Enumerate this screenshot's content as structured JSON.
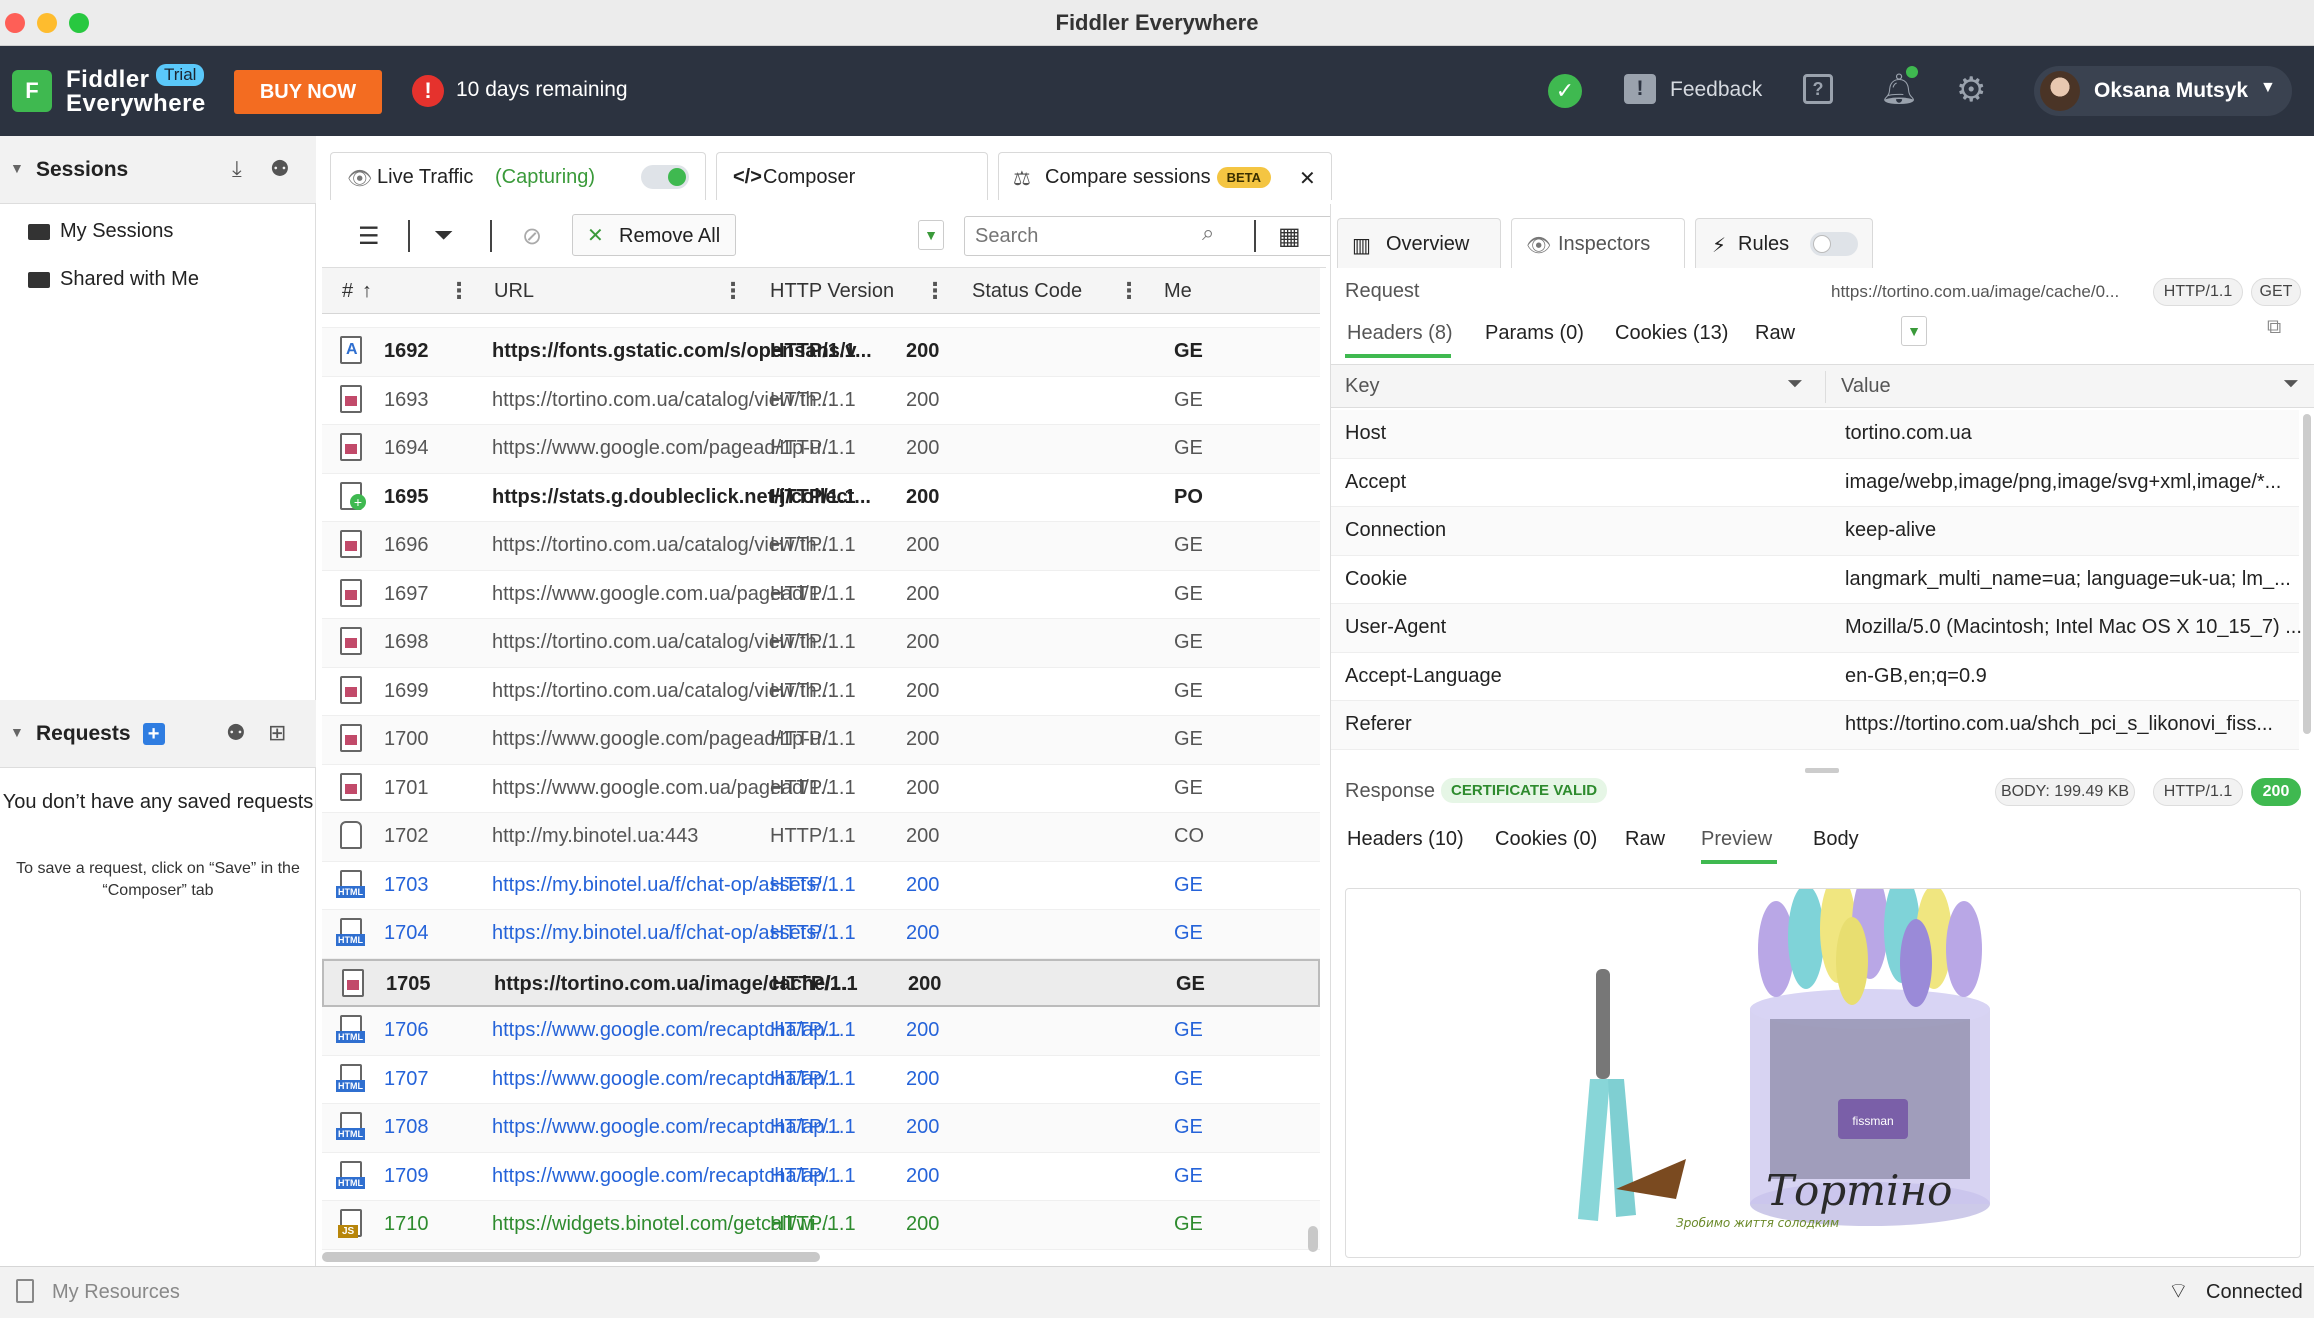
{
  "window": {
    "title": "Fiddler Everywhere"
  },
  "header": {
    "brand_line1": "Fiddler",
    "brand_line2": "Everywhere",
    "trial_badge": "Trial",
    "buy_now": "BUY NOW",
    "trial_remaining": "10 days remaining",
    "feedback": "Feedback",
    "user_name": "Oksana Mutsyk",
    "accent_color": "#f36c21"
  },
  "sidebar": {
    "sessions_title": "Sessions",
    "items": [
      {
        "label": "My Sessions"
      },
      {
        "label": "Shared with Me"
      }
    ],
    "requests_title": "Requests",
    "empty_title": "You don’t have any saved requests",
    "empty_hint": "To save a request, click on “Save” in the “Composer” tab"
  },
  "tabs": {
    "live_traffic": "Live Traffic",
    "capturing": "(Capturing)",
    "composer": "Composer",
    "compare_sessions": "Compare sessions",
    "beta": "BETA"
  },
  "toolbar": {
    "remove_all": "Remove All",
    "search_placeholder": "Search"
  },
  "grid": {
    "columns": [
      "#",
      "URL",
      "HTTP Version",
      "Status Code",
      "Me"
    ],
    "rows": [
      {
        "id": "1692",
        "url": "https://fonts.gstatic.com/s/opensans/v...",
        "version": "HTTP/1.1",
        "status": "200",
        "method": "GE",
        "icon": "font",
        "style": "bold"
      },
      {
        "id": "1693",
        "url": "https://tortino.com.ua/catalog/view/th...",
        "version": "HTTP/1.1",
        "status": "200",
        "method": "GE",
        "icon": "img",
        "style": "normal"
      },
      {
        "id": "1694",
        "url": "https://www.google.com/pagead/1p-u...",
        "version": "HTTP/1.1",
        "status": "200",
        "method": "GE",
        "icon": "img",
        "style": "normal"
      },
      {
        "id": "1695",
        "url": "https://stats.g.doubleclick.net/j/collect...",
        "version": "HTTP/1.1",
        "status": "200",
        "method": "PO",
        "icon": "post",
        "style": "bold"
      },
      {
        "id": "1696",
        "url": "https://tortino.com.ua/catalog/view/th...",
        "version": "HTTP/1.1",
        "status": "200",
        "method": "GE",
        "icon": "img",
        "style": "normal"
      },
      {
        "id": "1697",
        "url": "https://www.google.com.ua/pagead/1...",
        "version": "HTTP/1.1",
        "status": "200",
        "method": "GE",
        "icon": "img",
        "style": "normal"
      },
      {
        "id": "1698",
        "url": "https://tortino.com.ua/catalog/view/th...",
        "version": "HTTP/1.1",
        "status": "200",
        "method": "GE",
        "icon": "img",
        "style": "normal"
      },
      {
        "id": "1699",
        "url": "https://tortino.com.ua/catalog/view/th...",
        "version": "HTTP/1.1",
        "status": "200",
        "method": "GE",
        "icon": "img",
        "style": "normal"
      },
      {
        "id": "1700",
        "url": "https://www.google.com/pagead/1p-u...",
        "version": "HTTP/1.1",
        "status": "200",
        "method": "GE",
        "icon": "img",
        "style": "normal"
      },
      {
        "id": "1701",
        "url": "https://www.google.com.ua/pagead/1...",
        "version": "HTTP/1.1",
        "status": "200",
        "method": "GE",
        "icon": "img",
        "style": "normal"
      },
      {
        "id": "1702",
        "url": "http://my.binotel.ua:443",
        "version": "HTTP/1.1",
        "status": "200",
        "method": "CO",
        "icon": "lock",
        "style": "normal"
      },
      {
        "id": "1703",
        "url": "https://my.binotel.ua/f/chat-op/assets/...",
        "version": "HTTP/1.1",
        "status": "200",
        "method": "GE",
        "icon": "htm",
        "style": "blue"
      },
      {
        "id": "1704",
        "url": "https://my.binotel.ua/f/chat-op/assets/...",
        "version": "HTTP/1.1",
        "status": "200",
        "method": "GE",
        "icon": "htm",
        "style": "blue"
      },
      {
        "id": "1705",
        "url": "https://tortino.com.ua/image/cache/...",
        "version": "HTTP/1.1",
        "status": "200",
        "method": "GE",
        "icon": "img",
        "style": "selected"
      },
      {
        "id": "1706",
        "url": "https://www.google.com/recaptcha/ap...",
        "version": "HTTP/1.1",
        "status": "200",
        "method": "GE",
        "icon": "htm",
        "style": "blue"
      },
      {
        "id": "1707",
        "url": "https://www.google.com/recaptcha/ap...",
        "version": "HTTP/1.1",
        "status": "200",
        "method": "GE",
        "icon": "htm",
        "style": "blue"
      },
      {
        "id": "1708",
        "url": "https://www.google.com/recaptcha/ap...",
        "version": "HTTP/1.1",
        "status": "200",
        "method": "GE",
        "icon": "htm",
        "style": "blue"
      },
      {
        "id": "1709",
        "url": "https://www.google.com/recaptcha/ap...",
        "version": "HTTP/1.1",
        "status": "200",
        "method": "GE",
        "icon": "htm",
        "style": "blue"
      },
      {
        "id": "1710",
        "url": "https://widgets.binotel.com/getcall/wi...",
        "version": "HTTP/1.1",
        "status": "200",
        "method": "GE",
        "icon": "js",
        "style": "green"
      }
    ]
  },
  "inspector": {
    "tabs": [
      "Overview",
      "Inspectors",
      "Rules"
    ],
    "request_label": "Request",
    "request_url": "https://tortino.com.ua/image/cache/0...",
    "request_version": "HTTP/1.1",
    "request_method": "GET",
    "request_tabs": [
      "Headers (8)",
      "Params (0)",
      "Cookies (13)",
      "Raw"
    ],
    "columns": [
      "Key",
      "Value"
    ],
    "headers": [
      {
        "key": "Host",
        "value": "tortino.com.ua"
      },
      {
        "key": "Accept",
        "value": "image/webp,image/png,image/svg+xml,image/*..."
      },
      {
        "key": "Connection",
        "value": "keep-alive"
      },
      {
        "key": "Cookie",
        "value": "langmark_multi_name=ua; language=uk-ua; lm_..."
      },
      {
        "key": "User-Agent",
        "value": "Mozilla/5.0 (Macintosh; Intel Mac OS X 10_15_7) ..."
      },
      {
        "key": "Accept-Language",
        "value": "en-GB,en;q=0.9"
      },
      {
        "key": "Referer",
        "value": "https://tortino.com.ua/shch_pci_s_likonovi_fiss..."
      }
    ],
    "response_label": "Response",
    "certificate": "CERTIFICATE VALID",
    "body_size": "BODY: 199.49 KB",
    "response_version": "HTTP/1.1",
    "response_status": "200",
    "response_tabs": [
      "Headers (10)",
      "Cookies (0)",
      "Raw",
      "Preview",
      "Body"
    ],
    "preview_brand": "Тортіно",
    "preview_tagline": "Зробимо життя солодким",
    "preview_jar_label": "fissman"
  },
  "statusbar": {
    "my_resources": "My Resources",
    "connection": "Connected"
  }
}
